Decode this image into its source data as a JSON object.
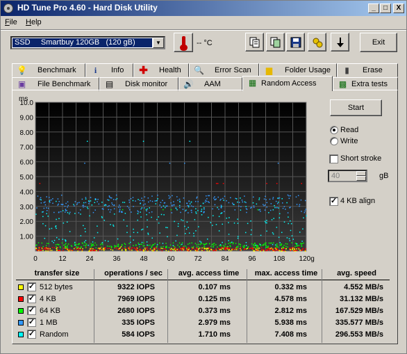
{
  "window": {
    "title": "HD Tune Pro 4.60 - Hard Disk Utility"
  },
  "title_buttons": {
    "minimize": "_",
    "maximize": "□",
    "close": "X"
  },
  "menu": {
    "file": "File",
    "help": "Help"
  },
  "drive": {
    "selected": "SSD     Smartbuy 120GB   (120 gB)"
  },
  "temperature": {
    "value": "-- °C"
  },
  "toolbar": {
    "exit_label": "Exit",
    "icons": [
      "copy-text-icon",
      "copy-screenshot-icon",
      "save-icon",
      "options-icon",
      "download-icon"
    ]
  },
  "tabs_top": [
    {
      "label": "Benchmark",
      "icon": "lightbulb-icon"
    },
    {
      "label": "Info",
      "icon": "info-icon"
    },
    {
      "label": "Health",
      "icon": "health-cross-icon"
    },
    {
      "label": "Error Scan",
      "icon": "magnifier-icon"
    },
    {
      "label": "Folder Usage",
      "icon": "folder-icon"
    },
    {
      "label": "Erase",
      "icon": "trash-icon"
    }
  ],
  "tabs_bottom": [
    {
      "label": "File Benchmark",
      "icon": "file-benchmark-icon"
    },
    {
      "label": "Disk monitor",
      "icon": "disk-monitor-icon"
    },
    {
      "label": "AAM",
      "icon": "speaker-icon"
    },
    {
      "label": "Random Access",
      "icon": "random-access-icon",
      "active": true
    },
    {
      "label": "Extra tests",
      "icon": "extra-tests-icon"
    }
  ],
  "controls": {
    "start_label": "Start",
    "read_label": "Read",
    "write_label": "Write",
    "read_selected": true,
    "short_stroke_label": "Short stroke",
    "short_stroke_checked": false,
    "short_stroke_value": "40",
    "short_stroke_unit": "gB",
    "align_label": "4 KB align",
    "align_checked": true
  },
  "chart_data": {
    "type": "scatter",
    "ylabel": "ms",
    "xlabel": "",
    "y_ticks": [
      "10.0",
      "9.00",
      "8.00",
      "7.00",
      "6.00",
      "5.00",
      "4.00",
      "3.00",
      "2.00",
      "1.00"
    ],
    "x_ticks": [
      "0",
      "12",
      "24",
      "36",
      "48",
      "60",
      "72",
      "84",
      "96",
      "108",
      "120gB"
    ],
    "xlim": [
      0,
      120
    ],
    "ylim": [
      0,
      10
    ],
    "grid": true,
    "background": "#1a1a1a",
    "series": [
      {
        "name": "512 bytes",
        "color": "#ffff00",
        "avg_ms": 0.107,
        "max_ms": 0.332
      },
      {
        "name": "4 KB",
        "color": "#ff0000",
        "avg_ms": 0.125,
        "max_ms": 4.578
      },
      {
        "name": "64 KB",
        "color": "#00ff00",
        "avg_ms": 0.373,
        "max_ms": 2.812
      },
      {
        "name": "1 MB",
        "color": "#3399ff",
        "avg_ms": 2.979,
        "max_ms": 5.938
      },
      {
        "name": "Random",
        "color": "#00ffff",
        "avg_ms": 1.71,
        "max_ms": 7.408
      }
    ]
  },
  "table": {
    "headers": [
      "transfer size",
      "operations / sec",
      "avg. access time",
      "max. access time",
      "avg. speed"
    ],
    "rows": [
      {
        "name": "512 bytes",
        "color": "#ffff00",
        "checked": "✓",
        "ops": "9322 IOPS",
        "avg": "0.107 ms",
        "max": "0.332 ms",
        "speed": "4.552 MB/s"
      },
      {
        "name": "4 KB",
        "color": "#ff0000",
        "checked": "✓",
        "ops": "7969 IOPS",
        "avg": "0.125 ms",
        "max": "4.578 ms",
        "speed": "31.132 MB/s"
      },
      {
        "name": "64 KB",
        "color": "#00ff00",
        "checked": "✓",
        "ops": "2680 IOPS",
        "avg": "0.373 ms",
        "max": "2.812 ms",
        "speed": "167.529 MB/s"
      },
      {
        "name": "1 MB",
        "color": "#3399ff",
        "checked": "✓",
        "ops": "335 IOPS",
        "avg": "2.979 ms",
        "max": "5.938 ms",
        "speed": "335.577 MB/s"
      },
      {
        "name": "Random",
        "color": "#00ffff",
        "checked": "✓",
        "ops": "584 IOPS",
        "avg": "1.710 ms",
        "max": "7.408 ms",
        "speed": "296.553 MB/s"
      }
    ]
  }
}
